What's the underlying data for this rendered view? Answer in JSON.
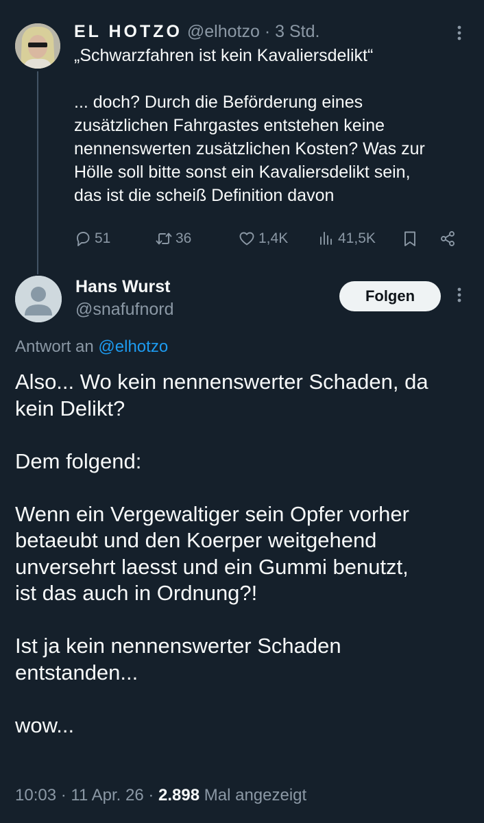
{
  "tweet1": {
    "name": "EL HOTZO",
    "handle": "@elhotzo",
    "time_sep": " · ",
    "time": "3 Std.",
    "quote": "„Schwarzfahren ist kein Kavaliersdelikt“",
    "lines": [
      "... doch? Durch die Beförderung eines",
      "zusätzlichen Fahrgastes entstehen keine",
      "nennenswerten zusätzlichen Kosten? Was zur",
      "Hölle soll bitte sonst ein Kavaliersdelikt sein,",
      "das ist die scheiß Definition davon"
    ],
    "actions": {
      "replies": "51",
      "retweets": "36",
      "likes": "1,4K",
      "views": "41,5K"
    }
  },
  "tweet2": {
    "name": "Hans Wurst",
    "handle": "@snafufnord",
    "follow_label": "Folgen",
    "reply_prefix": "Antwort an ",
    "reply_handle": "@elhotzo",
    "paragraphs": [
      [
        "Also... Wo kein nennenswerter Schaden, da",
        "kein Delikt?"
      ],
      [
        "Dem folgend:"
      ],
      [
        "Wenn ein Vergewaltiger sein Opfer vorher",
        "betaeubt und den Koerper weitgehend",
        "unversehrt laesst und ein Gummi benutzt,",
        "ist das auch in Ordnung?!"
      ],
      [
        "Ist ja kein nennenswerter Schaden",
        "entstanden..."
      ],
      [
        "wow..."
      ]
    ],
    "footer": {
      "time": "10:03",
      "sep1": " · ",
      "date": "11 Apr. 26",
      "sep2": " · ",
      "views_count": "2.898",
      "views_label": " Mal angezeigt"
    }
  },
  "icons": [
    "more-icon",
    "reply-icon",
    "retweet-icon",
    "like-icon",
    "views-icon",
    "bookmark-icon",
    "share-icon"
  ],
  "colors": {
    "background": "#15202b",
    "text": "#f7f9f9",
    "muted": "#8b98a5",
    "link": "#1d9bf0",
    "thread_line": "#425364",
    "button_bg": "#eff3f4"
  }
}
